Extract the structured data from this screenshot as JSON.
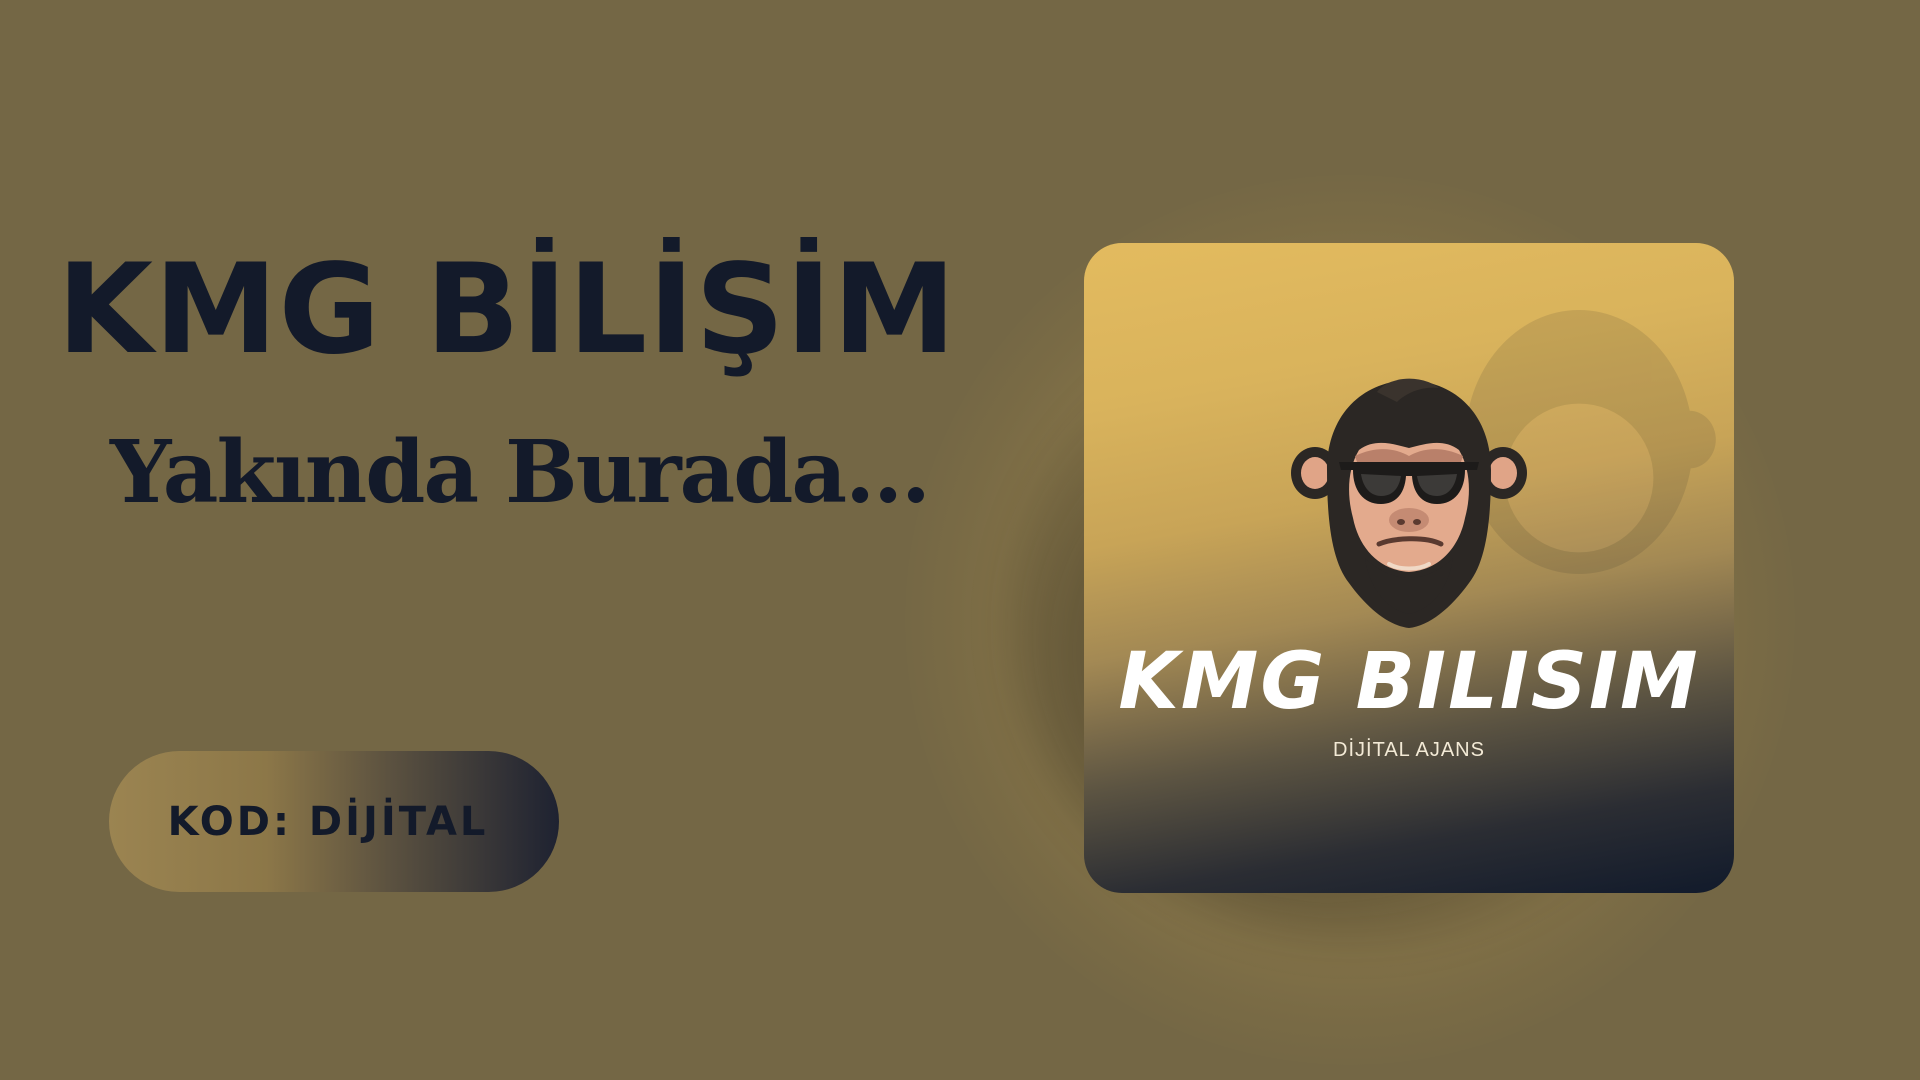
{
  "hero": {
    "title": "KMG BİLİŞİM",
    "tagline": "Yakında Burada..."
  },
  "code_button": {
    "label": "KOD: DİJİTAL"
  },
  "logo": {
    "wordmark": "KMG BILISIM",
    "subtitle": "DİJİTAL AJANS",
    "icon": "monkey-sunglasses-icon"
  },
  "colors": {
    "background": "#746745",
    "text_dark": "#131a2a",
    "gold": "#e3bb5f",
    "navy": "#111a2b"
  }
}
